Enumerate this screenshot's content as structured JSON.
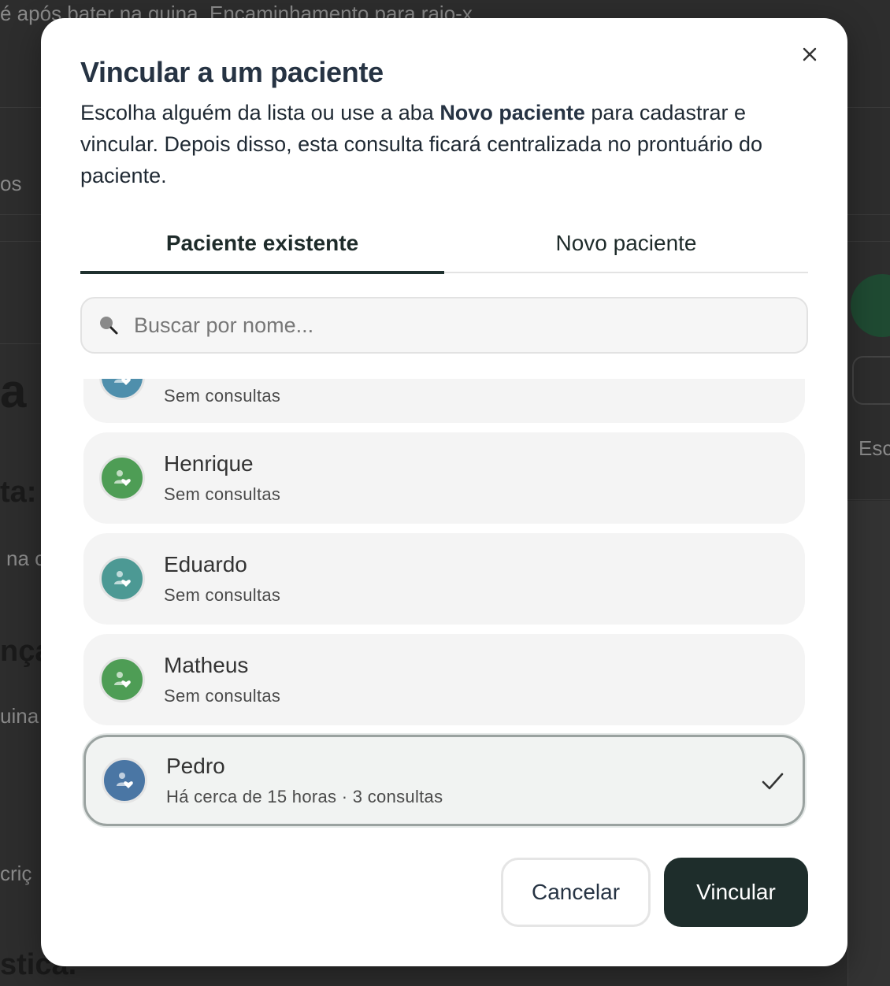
{
  "background": {
    "top_text": "é após bater na quina. Encaminhamento para raio-x",
    "fragments": [
      "os",
      "a",
      "ta:",
      "na c",
      "nça",
      "uina",
      "criç",
      "stica.",
      "Esc"
    ]
  },
  "modal": {
    "title": "Vincular a um paciente",
    "desc_before": "Escolha alguém da lista ou use a aba ",
    "desc_strong": "Novo paciente",
    "desc_after": " para cadastrar e vincular. Depois disso, esta consulta ficará centralizada no prontuário do paciente.",
    "close_label": "×",
    "tabs": [
      {
        "label": "Paciente existente",
        "active": true
      },
      {
        "label": "Novo paciente",
        "active": false
      }
    ],
    "search": {
      "placeholder": "Buscar por nome...",
      "value": ""
    },
    "patients": [
      {
        "name": "",
        "subtitle": "Sem consultas",
        "color": "#4f8fac",
        "selected": false
      },
      {
        "name": "Henrique",
        "subtitle": "Sem consultas",
        "color": "#4e9d55",
        "selected": false
      },
      {
        "name": "Eduardo",
        "subtitle": "Sem consultas",
        "color": "#4c9994",
        "selected": false
      },
      {
        "name": "Matheus",
        "subtitle": "Sem consultas",
        "color": "#4e9d55",
        "selected": false
      },
      {
        "name": "Pedro",
        "subtitle": "Há cerca de 15 horas · 3 consultas",
        "color": "#4a76a4",
        "selected": true
      }
    ],
    "cancel_label": "Cancelar",
    "submit_label": "Vincular"
  },
  "colors": {
    "primary": "#1e2d2b",
    "title": "#263343"
  }
}
